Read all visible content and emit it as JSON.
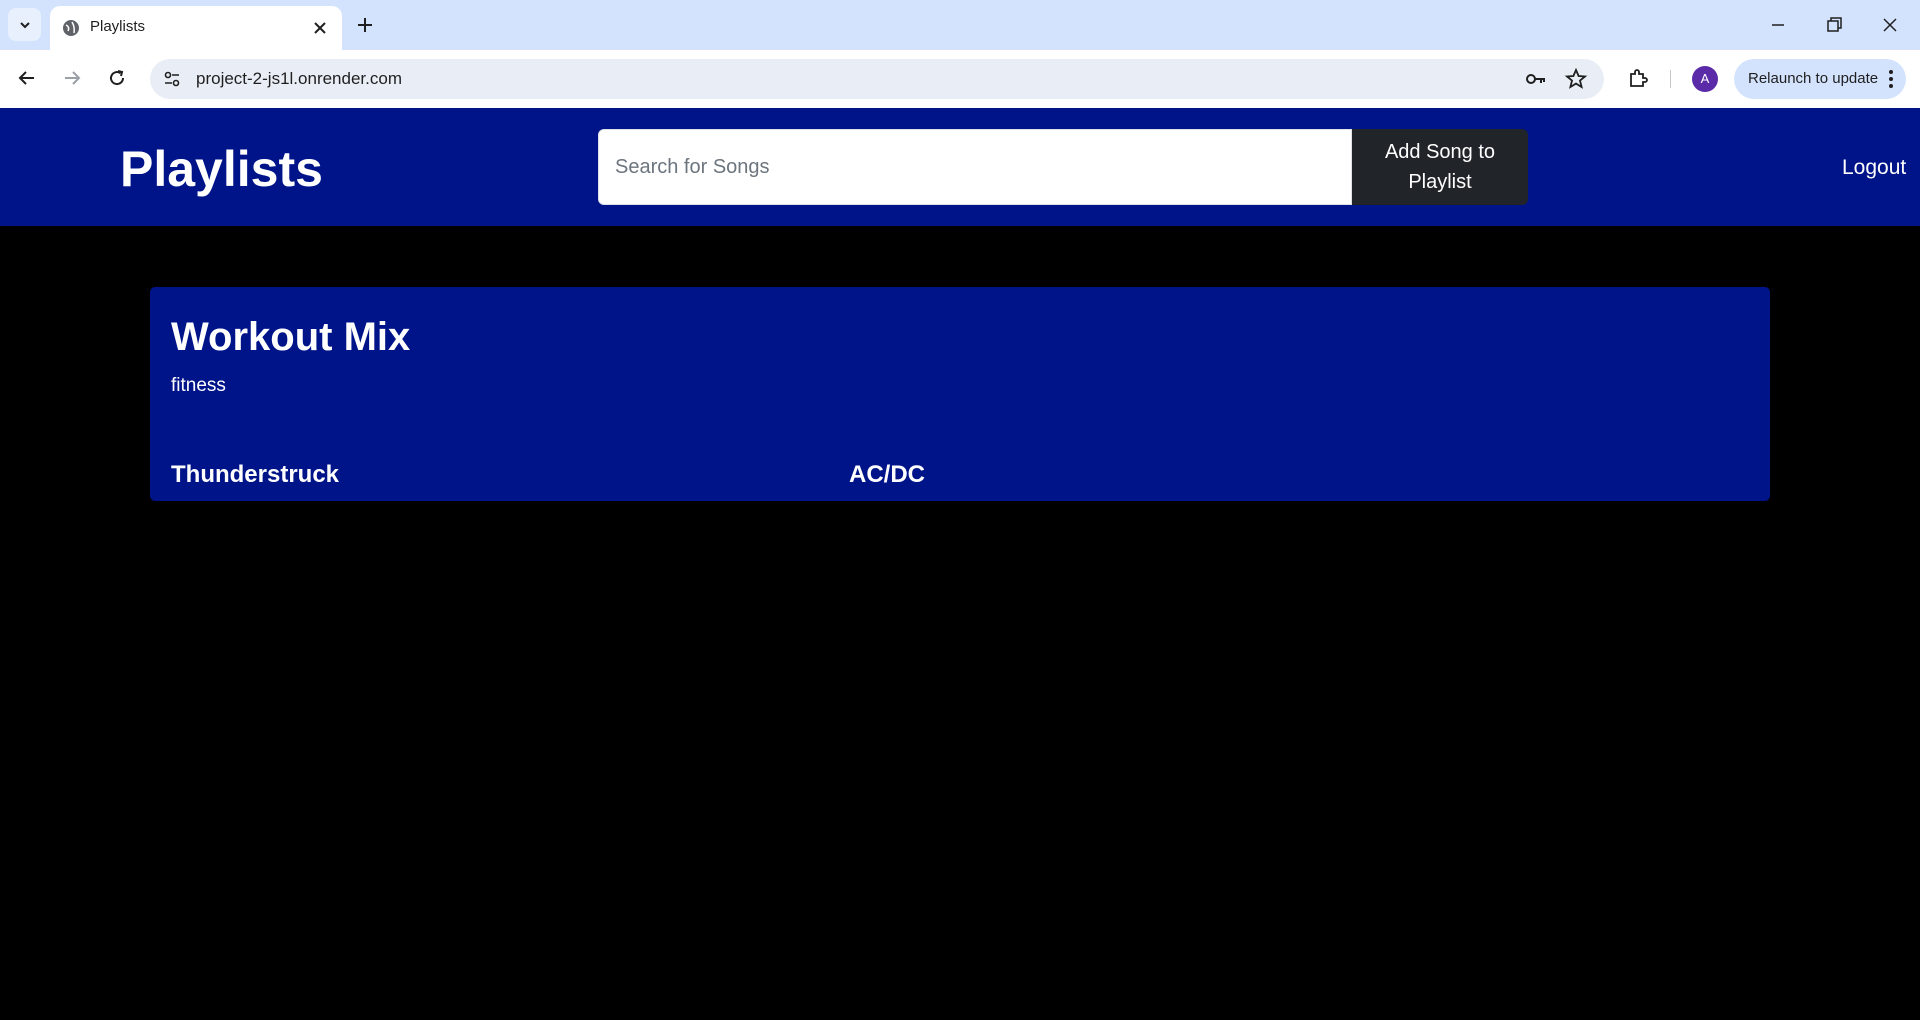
{
  "browser": {
    "tab_title": "Playlists",
    "url": "project-2-js1l.onrender.com",
    "profile_initial": "A",
    "relaunch_label": "Relaunch to update"
  },
  "header": {
    "brand": "Playlists",
    "search_placeholder": "Search for Songs",
    "add_button_label": "Add Song to Playlist",
    "logout_label": "Logout"
  },
  "playlist": {
    "title": "Workout Mix",
    "tag": "fitness",
    "songs": [
      {
        "title": "Thunderstruck",
        "artist": "AC/DC"
      }
    ]
  },
  "colors": {
    "header_bg": "#001489",
    "page_bg": "#000000",
    "button_bg": "#212529"
  }
}
